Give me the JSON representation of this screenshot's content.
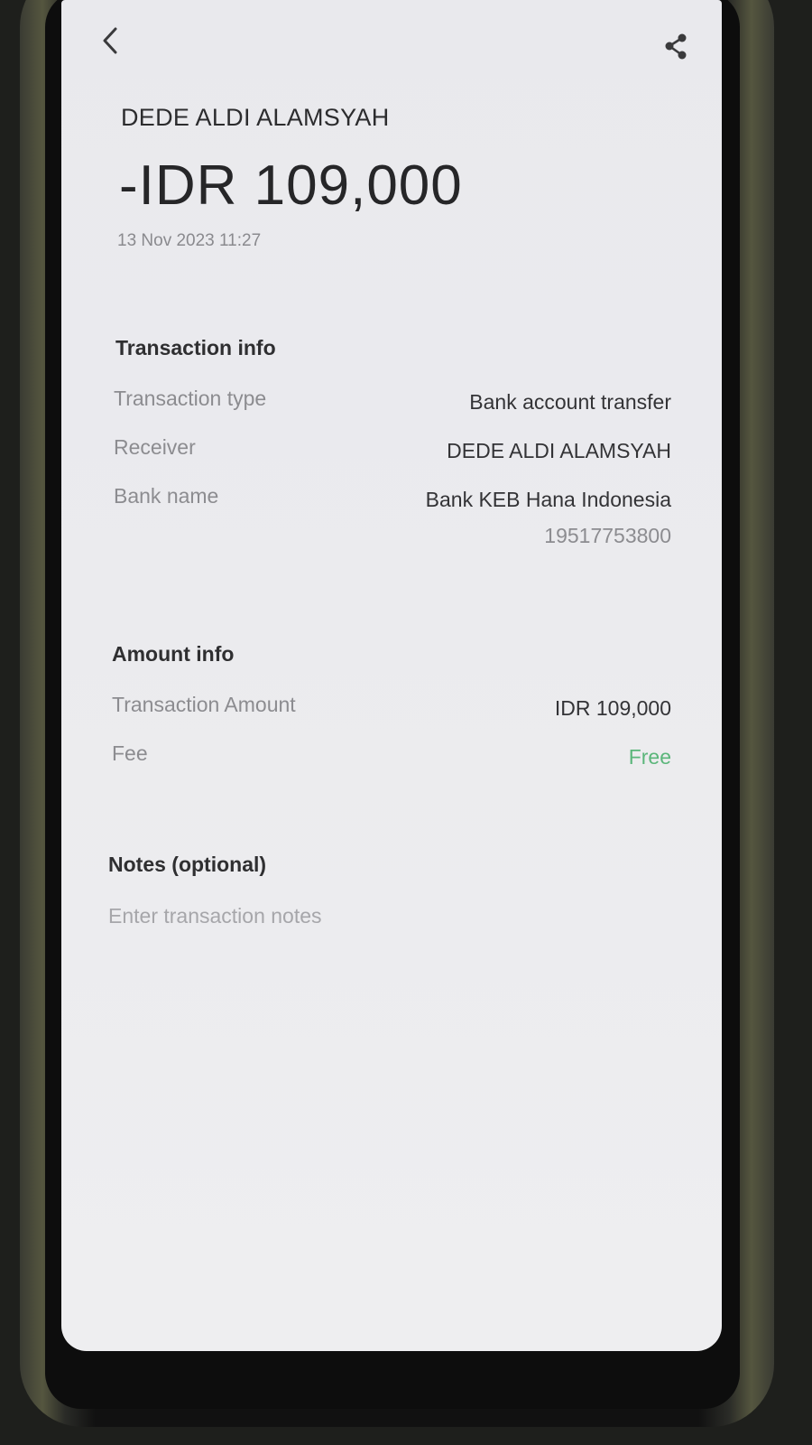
{
  "header": {
    "back_icon": "chevron-left-icon",
    "share_icon": "share-icon"
  },
  "summary": {
    "payee": "DEDE ALDI ALAMSYAH",
    "amount": "-IDR 109,000",
    "datetime": "13 Nov 2023 11:27"
  },
  "transaction_info": {
    "title": "Transaction info",
    "type_label": "Transaction type",
    "type_value": "Bank account transfer",
    "receiver_label": "Receiver",
    "receiver_value": "DEDE ALDI ALAMSYAH",
    "bank_label": "Bank name",
    "bank_value": "Bank KEB Hana Indonesia",
    "account_number": "19517753800"
  },
  "amount_info": {
    "title": "Amount info",
    "amount_label": "Transaction Amount",
    "amount_value": "IDR 109,000",
    "fee_label": "Fee",
    "fee_value": "Free",
    "fee_color": "#5bb67a"
  },
  "notes": {
    "title": "Notes (optional)",
    "placeholder": "Enter transaction notes",
    "value": ""
  }
}
